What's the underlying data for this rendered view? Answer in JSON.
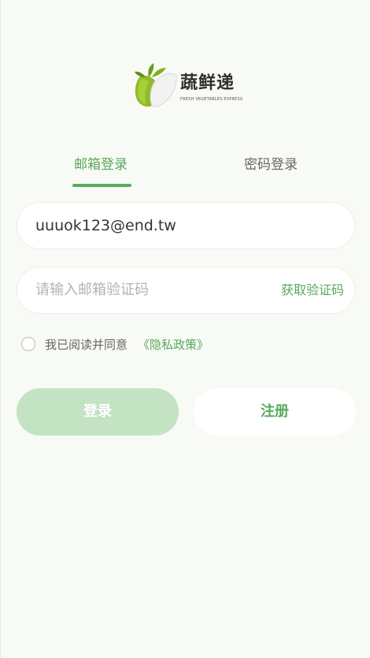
{
  "brand": {
    "name": "蔬鲜递",
    "tagline": "FRESH VEGETABLES EXPRESS"
  },
  "tabs": [
    {
      "label": "邮箱登录",
      "active": true
    },
    {
      "label": "密码登录",
      "active": false
    }
  ],
  "email_field": {
    "value": "uuuok123@end.tw"
  },
  "code_field": {
    "placeholder": "请输入邮箱验证码",
    "get_code_label": "获取验证码"
  },
  "agreement": {
    "text": "我已阅读并同意",
    "link": "《隐私政策》",
    "checked": false
  },
  "buttons": {
    "login": "登录",
    "register": "注册"
  },
  "colors": {
    "accent": "#5aa85e",
    "login_disabled": "#c3e3c3",
    "background": "#f8faf5"
  }
}
